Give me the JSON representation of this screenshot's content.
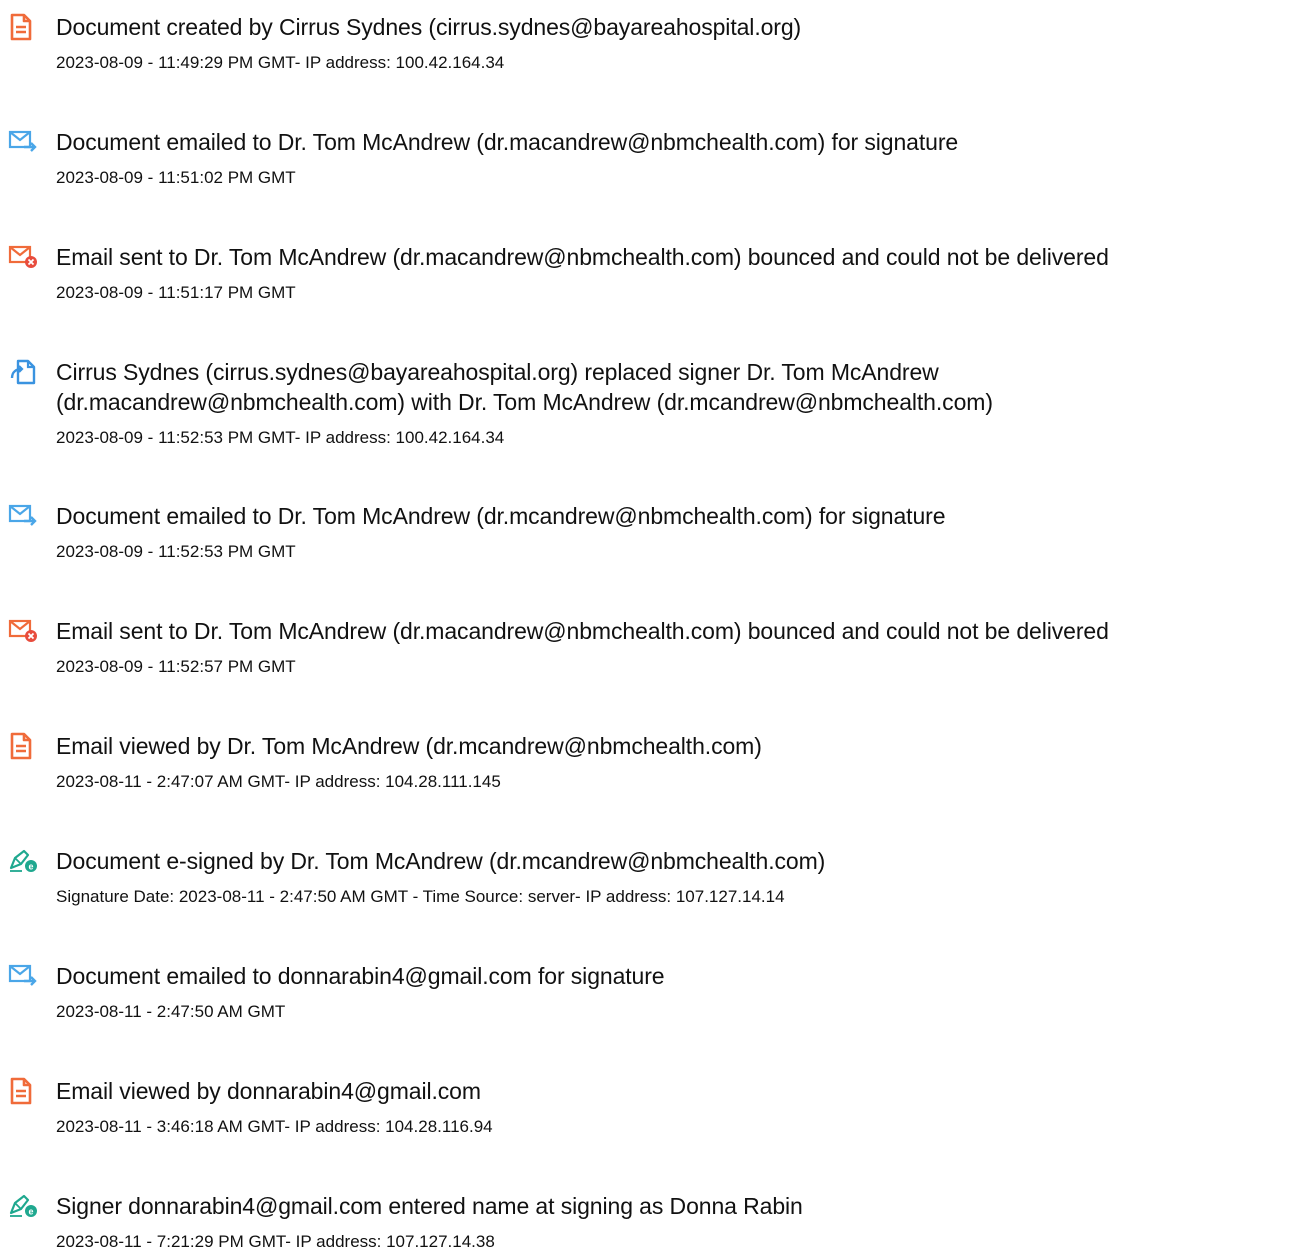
{
  "icon_colors": {
    "document": "#f06b3a",
    "email_sent": "#4aa6e8",
    "email_bounced": "#f06b3a",
    "bounced_badge": "#e84c3d",
    "replaced": "#3a93e0",
    "esign": "#1fa88f"
  },
  "events": [
    {
      "icon": "document-icon",
      "title_lines": [
        "Document created by Cirrus Sydnes (cirrus.sydnes@bayareahospital.org)"
      ],
      "meta": "2023-08-09 - 11:49:29 PM GMT- IP address: 100.42.164.34"
    },
    {
      "icon": "email-sent-icon",
      "title_lines": [
        "Document emailed to Dr. Tom McAndrew (dr.macandrew@nbmchealth.com) for signature"
      ],
      "meta": "2023-08-09 - 11:51:02 PM GMT"
    },
    {
      "icon": "email-bounced-icon",
      "title_lines": [
        "Email sent to Dr. Tom McAndrew (dr.macandrew@nbmchealth.com) bounced and could not be delivered"
      ],
      "meta": "2023-08-09 - 11:51:17 PM GMT"
    },
    {
      "icon": "replace-signer-icon",
      "title_lines": [
        "Cirrus Sydnes (cirrus.sydnes@bayareahospital.org) replaced signer Dr. Tom McAndrew",
        "(dr.macandrew@nbmchealth.com) with Dr. Tom McAndrew (dr.mcandrew@nbmchealth.com)"
      ],
      "meta": "2023-08-09 - 11:52:53 PM GMT- IP address: 100.42.164.34"
    },
    {
      "icon": "email-sent-icon",
      "title_lines": [
        "Document emailed to Dr. Tom McAndrew (dr.mcandrew@nbmchealth.com) for signature"
      ],
      "meta": "2023-08-09 - 11:52:53 PM GMT"
    },
    {
      "icon": "email-bounced-icon",
      "title_lines": [
        "Email sent to Dr. Tom McAndrew (dr.macandrew@nbmchealth.com) bounced and could not be delivered"
      ],
      "meta": "2023-08-09 - 11:52:57 PM GMT"
    },
    {
      "icon": "document-icon",
      "title_lines": [
        "Email viewed by Dr. Tom McAndrew (dr.mcandrew@nbmchealth.com)"
      ],
      "meta": "2023-08-11 - 2:47:07 AM GMT- IP address: 104.28.111.145"
    },
    {
      "icon": "esign-pen-icon",
      "title_lines": [
        "Document e-signed by Dr. Tom McAndrew (dr.mcandrew@nbmchealth.com)"
      ],
      "meta": "Signature Date: 2023-08-11 - 2:47:50 AM GMT - Time Source: server- IP address: 107.127.14.14"
    },
    {
      "icon": "email-sent-icon",
      "title_lines": [
        "Document emailed to donnarabin4@gmail.com for signature"
      ],
      "meta": "2023-08-11 - 2:47:50 AM GMT"
    },
    {
      "icon": "document-icon",
      "title_lines": [
        "Email viewed by donnarabin4@gmail.com"
      ],
      "meta": "2023-08-11 - 3:46:18 AM GMT- IP address: 104.28.116.94"
    },
    {
      "icon": "esign-pen-icon",
      "title_lines": [
        "Signer donnarabin4@gmail.com entered name at signing as Donna Rabin"
      ],
      "meta": "2023-08-11 - 7:21:29 PM GMT- IP address: 107.127.14.38"
    }
  ]
}
